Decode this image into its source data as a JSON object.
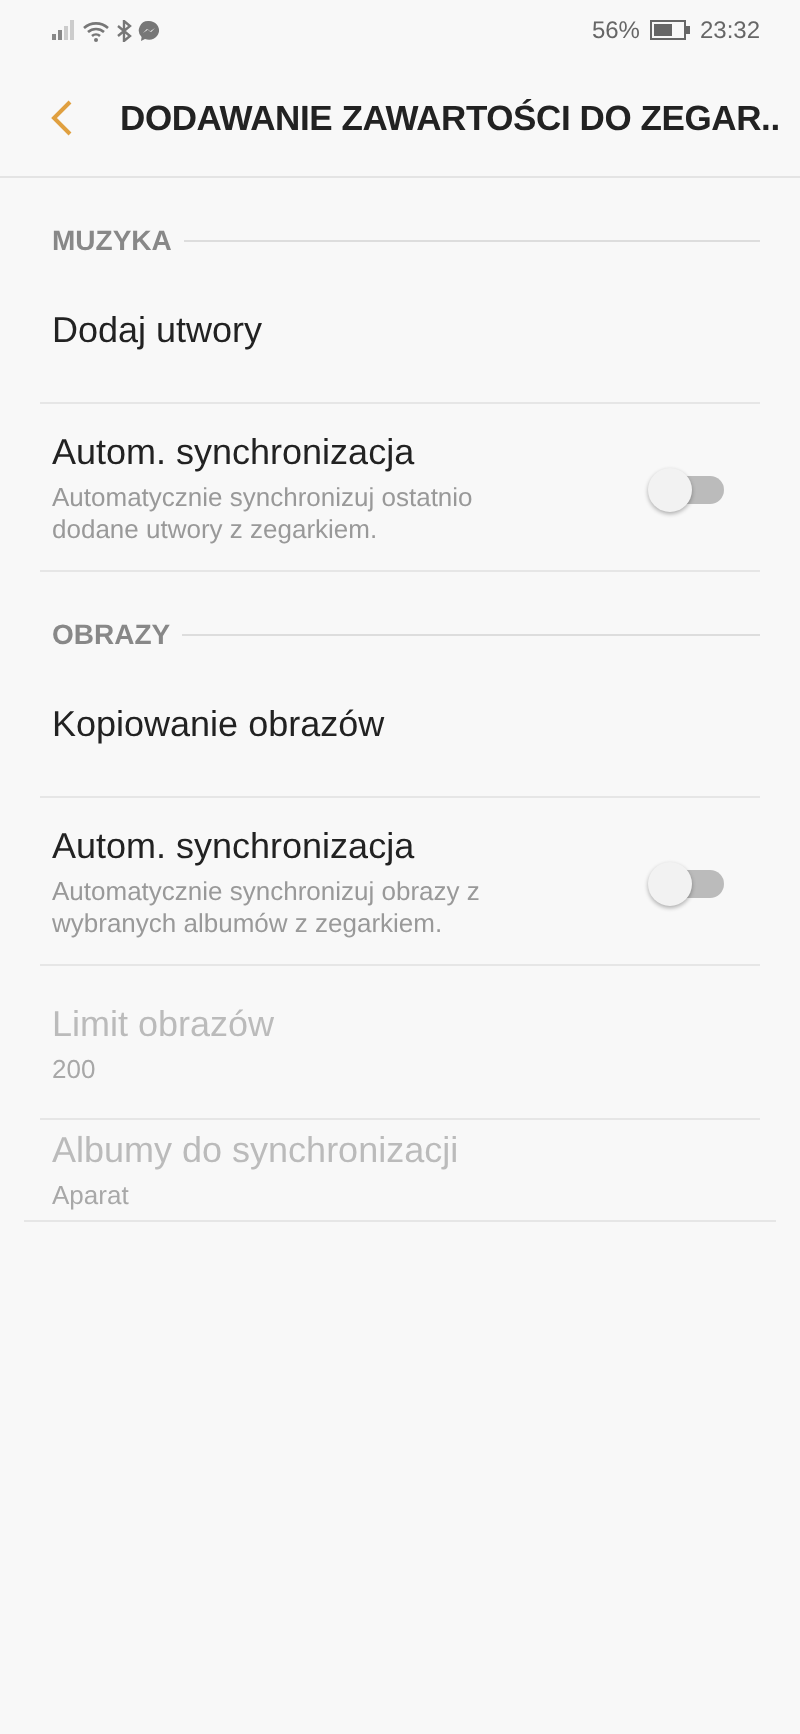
{
  "status_bar": {
    "battery_text": "56%",
    "time": "23:32"
  },
  "header": {
    "title": "DODAWANIE ZAWARTOŚCI DO ZEGAR.."
  },
  "sections": [
    {
      "title": "MUZYKA",
      "items": [
        {
          "kind": "link",
          "title": "Dodaj utwory",
          "disabled": false
        },
        {
          "kind": "switch",
          "title": "Autom. synchronizacja",
          "summary": "Automatycznie synchronizuj ostatnio dodane utwory z zegarkiem.",
          "on": false,
          "disabled": false
        }
      ]
    },
    {
      "title": "OBRAZY",
      "items": [
        {
          "kind": "link",
          "title": "Kopiowanie obrazów",
          "disabled": false
        },
        {
          "kind": "switch",
          "title": "Autom. synchronizacja",
          "summary": "Automatycznie synchronizuj obrazy z wybranych albumów z zegarkiem.",
          "on": false,
          "disabled": false
        },
        {
          "kind": "value",
          "title": "Limit obrazów",
          "summary": "200",
          "disabled": true
        },
        {
          "kind": "value",
          "title": "Albumy do synchronizacji",
          "summary": "Aparat",
          "disabled": true
        }
      ]
    }
  ]
}
